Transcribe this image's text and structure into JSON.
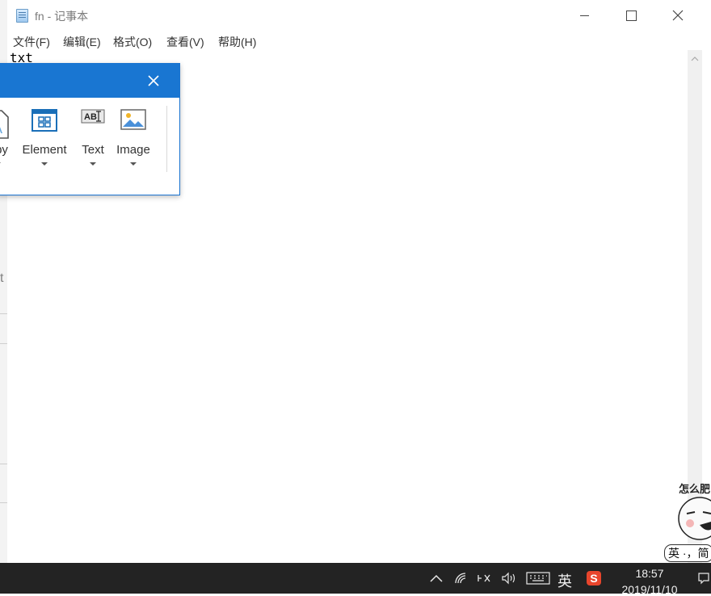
{
  "background_window": {
    "partial_text": "t"
  },
  "window": {
    "title": "fn - 记事本",
    "icon": "notepad-icon"
  },
  "menu": {
    "items": [
      {
        "label": "文件(F)"
      },
      {
        "label": "编辑(E)"
      },
      {
        "label": "格式(O)"
      },
      {
        "label": "查看(V)"
      },
      {
        "label": "帮助(H)"
      }
    ]
  },
  "editor": {
    "content": "txt"
  },
  "popup": {
    "accent_color": "#1976d2",
    "tools": [
      {
        "label": "Copy",
        "visible_label": "py",
        "icon": "copy-icon"
      },
      {
        "label": "Element",
        "icon": "element-icon"
      },
      {
        "label": "Text",
        "icon": "text-icon"
      },
      {
        "label": "Image",
        "icon": "image-icon"
      }
    ]
  },
  "sticker": {
    "top_text": "怎么肥",
    "bottom_text": "英 ·，简"
  },
  "taskbar": {
    "ime_label": "英",
    "time": "18:57",
    "date": "2019/11/10"
  }
}
